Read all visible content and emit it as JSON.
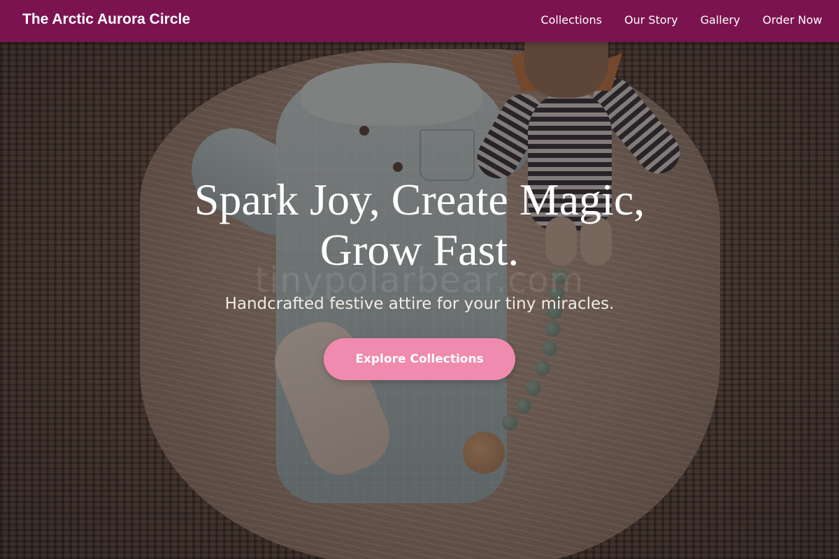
{
  "brand": {
    "name": "The Arctic Aurora Circle"
  },
  "nav": {
    "links": [
      {
        "label": "Collections"
      },
      {
        "label": "Our Story"
      },
      {
        "label": "Gallery"
      },
      {
        "label": "Order Now"
      }
    ]
  },
  "hero": {
    "headline_line1": "Spark Joy, Create Magic,",
    "headline_line2": "Grow Fast.",
    "subtitle": "Handcrafted festive attire for your tiny miracles.",
    "cta_label": "Explore Collections",
    "watermark": "tinypolarbear.com"
  },
  "colors": {
    "navbar": "#7c1351",
    "cta": "#f08aae",
    "text": "#ffffff"
  }
}
